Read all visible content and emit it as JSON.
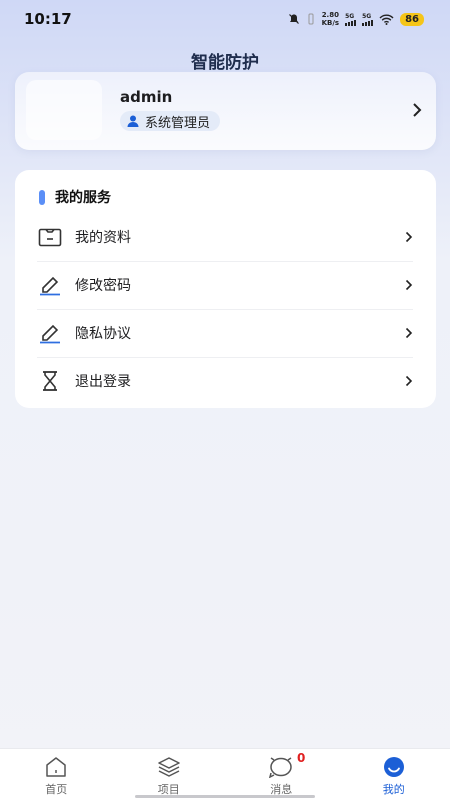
{
  "status_bar": {
    "time": "10:17",
    "net_speed_value": "2.80",
    "net_speed_unit": "KB/s",
    "signal1_label": "5G",
    "signal2_label": "5G",
    "battery": "86"
  },
  "header": {
    "title": "智能防护"
  },
  "profile": {
    "username": "admin",
    "role": "系统管理员"
  },
  "services": {
    "title": "我的服务",
    "items": [
      {
        "label": "我的资料",
        "icon": "id-card-icon"
      },
      {
        "label": "修改密码",
        "icon": "pencil-icon"
      },
      {
        "label": "隐私协议",
        "icon": "pencil-icon"
      },
      {
        "label": "退出登录",
        "icon": "hourglass-icon"
      }
    ]
  },
  "tabbar": {
    "tabs": [
      {
        "label": "首页",
        "icon": "home-icon"
      },
      {
        "label": "项目",
        "icon": "layers-icon"
      },
      {
        "label": "消息",
        "icon": "message-icon",
        "badge": "0"
      },
      {
        "label": "我的",
        "icon": "user-icon",
        "active": true
      }
    ]
  },
  "colors": {
    "accent": "#1c5fd6",
    "section_bar": "#5b8ff7",
    "badge": "#e02020"
  }
}
